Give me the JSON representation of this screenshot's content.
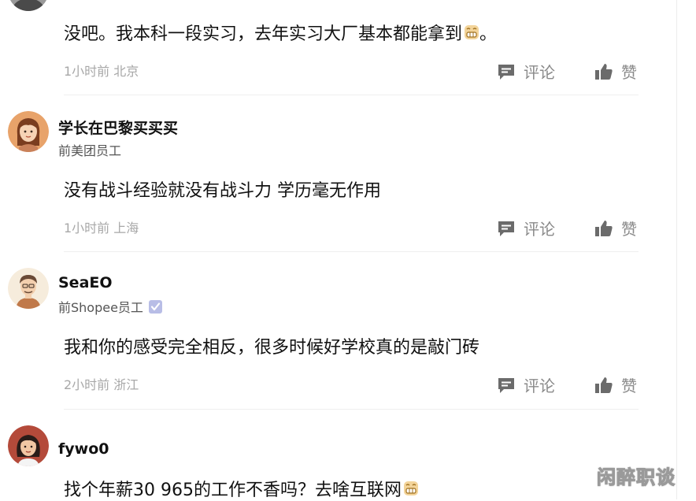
{
  "comments": [
    {
      "username": "",
      "role": "",
      "text": "没吧。我本科一段实习，去年实习大厂基本都能拿到",
      "text_tail": "。",
      "time": "1小时前",
      "location": "北京",
      "reply_label": "评论",
      "like_label": "赞"
    },
    {
      "username": "学长在巴黎买买买",
      "role": "前美团员工",
      "text": "没有战斗经验就没有战斗力 学历毫无作用",
      "time": "1小时前",
      "location": "上海",
      "reply_label": "评论",
      "like_label": "赞"
    },
    {
      "username": "SeaEO",
      "role": "前Shopee员工",
      "text": "我和你的感受完全相反，很多时候好学校真的是敲门砖",
      "time": "2小时前",
      "location": "浙江",
      "reply_label": "评论",
      "like_label": "赞"
    },
    {
      "username": "fywo0",
      "role": "",
      "text": "找个年薪30 965的工作不香吗？去啥互联网",
      "time": "",
      "location": "",
      "reply_label": "",
      "like_label": ""
    }
  ],
  "watermark": "闲醉职谈",
  "icons": {
    "reply": "comment-bubble-icon",
    "like": "thumbs-up-icon",
    "verified": "verified-check-icon",
    "emoji": "grin-emoji-icon"
  },
  "colors": {
    "meta_text": "#a8a8a8",
    "action": "#8a8a8a",
    "badge": "#b8bde6"
  }
}
